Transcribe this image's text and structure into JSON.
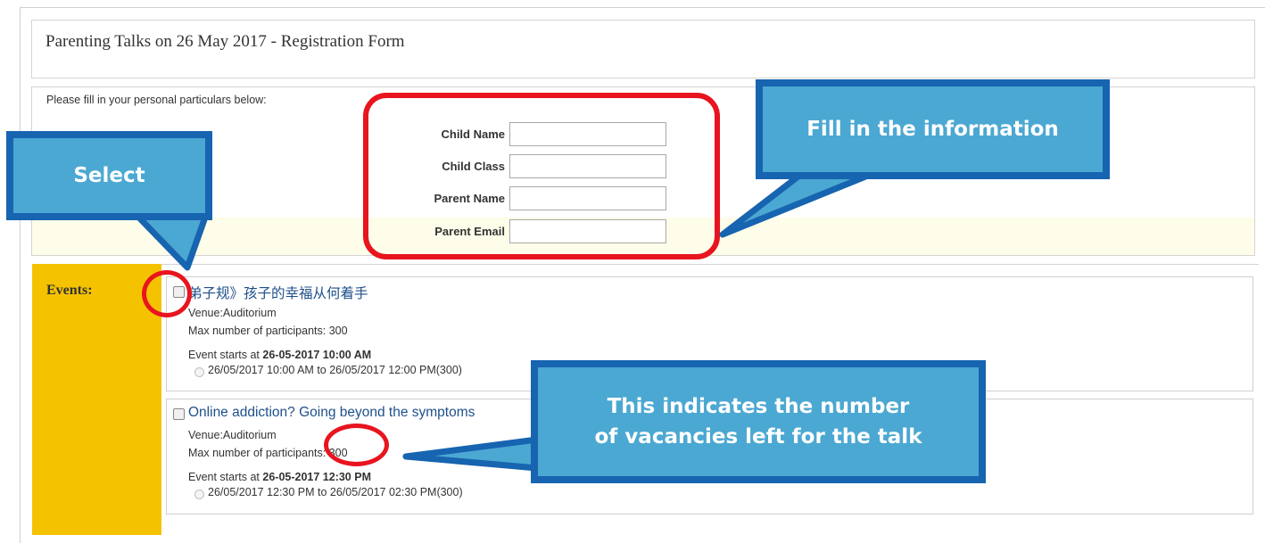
{
  "form": {
    "title": "Parenting Talks on 26 May 2017 - Registration Form",
    "instruction": "Please fill in your personal particulars below:",
    "fields": [
      {
        "label": "Child Name",
        "value": ""
      },
      {
        "label": "Child Class",
        "value": ""
      },
      {
        "label": "Parent Name",
        "value": ""
      },
      {
        "label": "Parent Email",
        "value": ""
      }
    ]
  },
  "events": {
    "label": "Events:",
    "items": [
      {
        "title": "弟子规》孩子的幸福从何着手",
        "venue": "Venue:Auditorium",
        "max": "Max number of participants: 300",
        "starts_prefix": "Event starts at ",
        "starts_value": "26-05-2017 10:00 AM",
        "slot": "26/05/2017 10:00 AM to 26/05/2017 12:00 PM(300)"
      },
      {
        "title": "Online addiction? Going beyond the symptoms",
        "venue": "Venue:Auditorium",
        "max": "Max number of participants: 300",
        "starts_prefix": "Event starts at ",
        "starts_value": "26-05-2017 12:30 PM",
        "slot": "26/05/2017 12:30 PM to 26/05/2017 02:30 PM(300)"
      }
    ]
  },
  "annotations": {
    "select": "Select",
    "fill_info": "Fill in the information",
    "vacancies_line1": "This indicates the number",
    "vacancies_line2": "of vacancies left for the talk"
  },
  "colors": {
    "events_yellow": "#f5c200",
    "callout_fill": "#4ba8d2",
    "callout_border": "#1764b0",
    "highlight_red": "#e8141e",
    "event_title": "#1f4f8a"
  }
}
